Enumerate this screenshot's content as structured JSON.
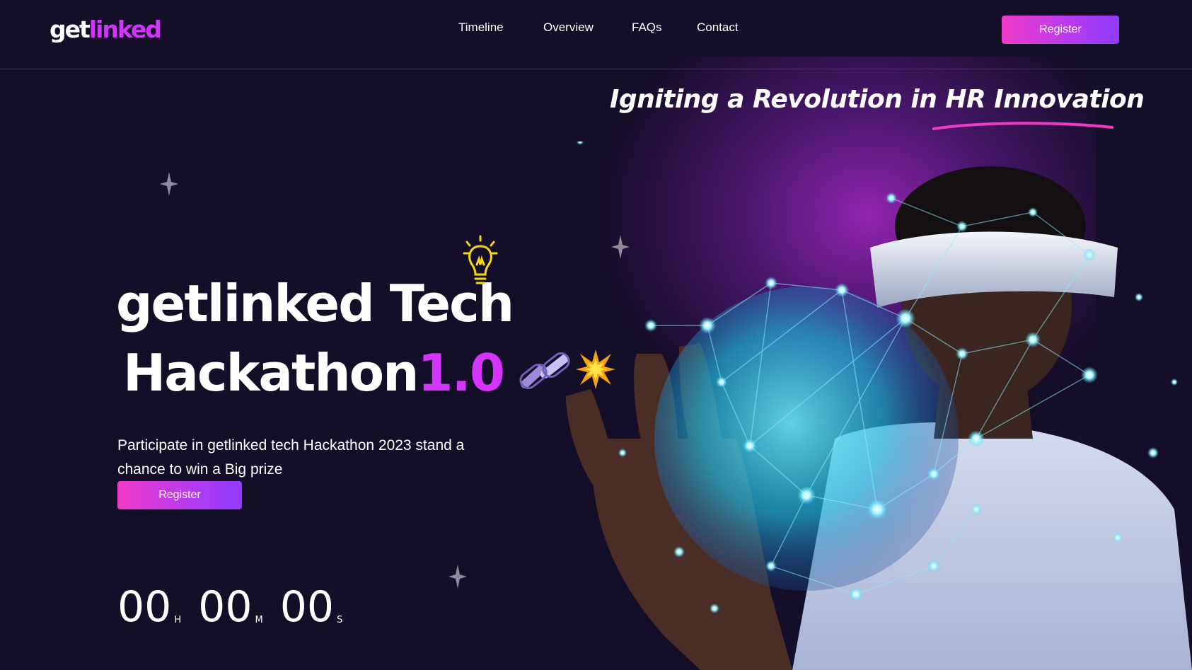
{
  "brand": {
    "logo_part1": "get",
    "logo_part2": "linked",
    "accent": "#d434fe"
  },
  "nav": {
    "links": [
      "Timeline",
      "Overview",
      "FAQs",
      "Contact"
    ],
    "register_label": "Register"
  },
  "hero": {
    "tagline": "Igniting a Revolution in HR Innovation",
    "title_line1": "getlinked Tech",
    "title_line2": "Hackathon",
    "version": "1.0",
    "description": "Participate in getlinked tech Hackathon 2023 stand a chance to win a Big prize",
    "register_label": "Register",
    "icons": [
      "lightbulb-icon",
      "chain-link-icon",
      "sparkle-burst-icon",
      "star-icon"
    ]
  },
  "countdown": {
    "hours": "00",
    "hours_unit": "H",
    "minutes": "00",
    "minutes_unit": "M",
    "seconds": "00",
    "seconds_unit": "S"
  },
  "colors": {
    "background": "#150e28",
    "button_start": "#f03bc7",
    "button_end": "#903aff",
    "underline": "#f03bc7"
  }
}
